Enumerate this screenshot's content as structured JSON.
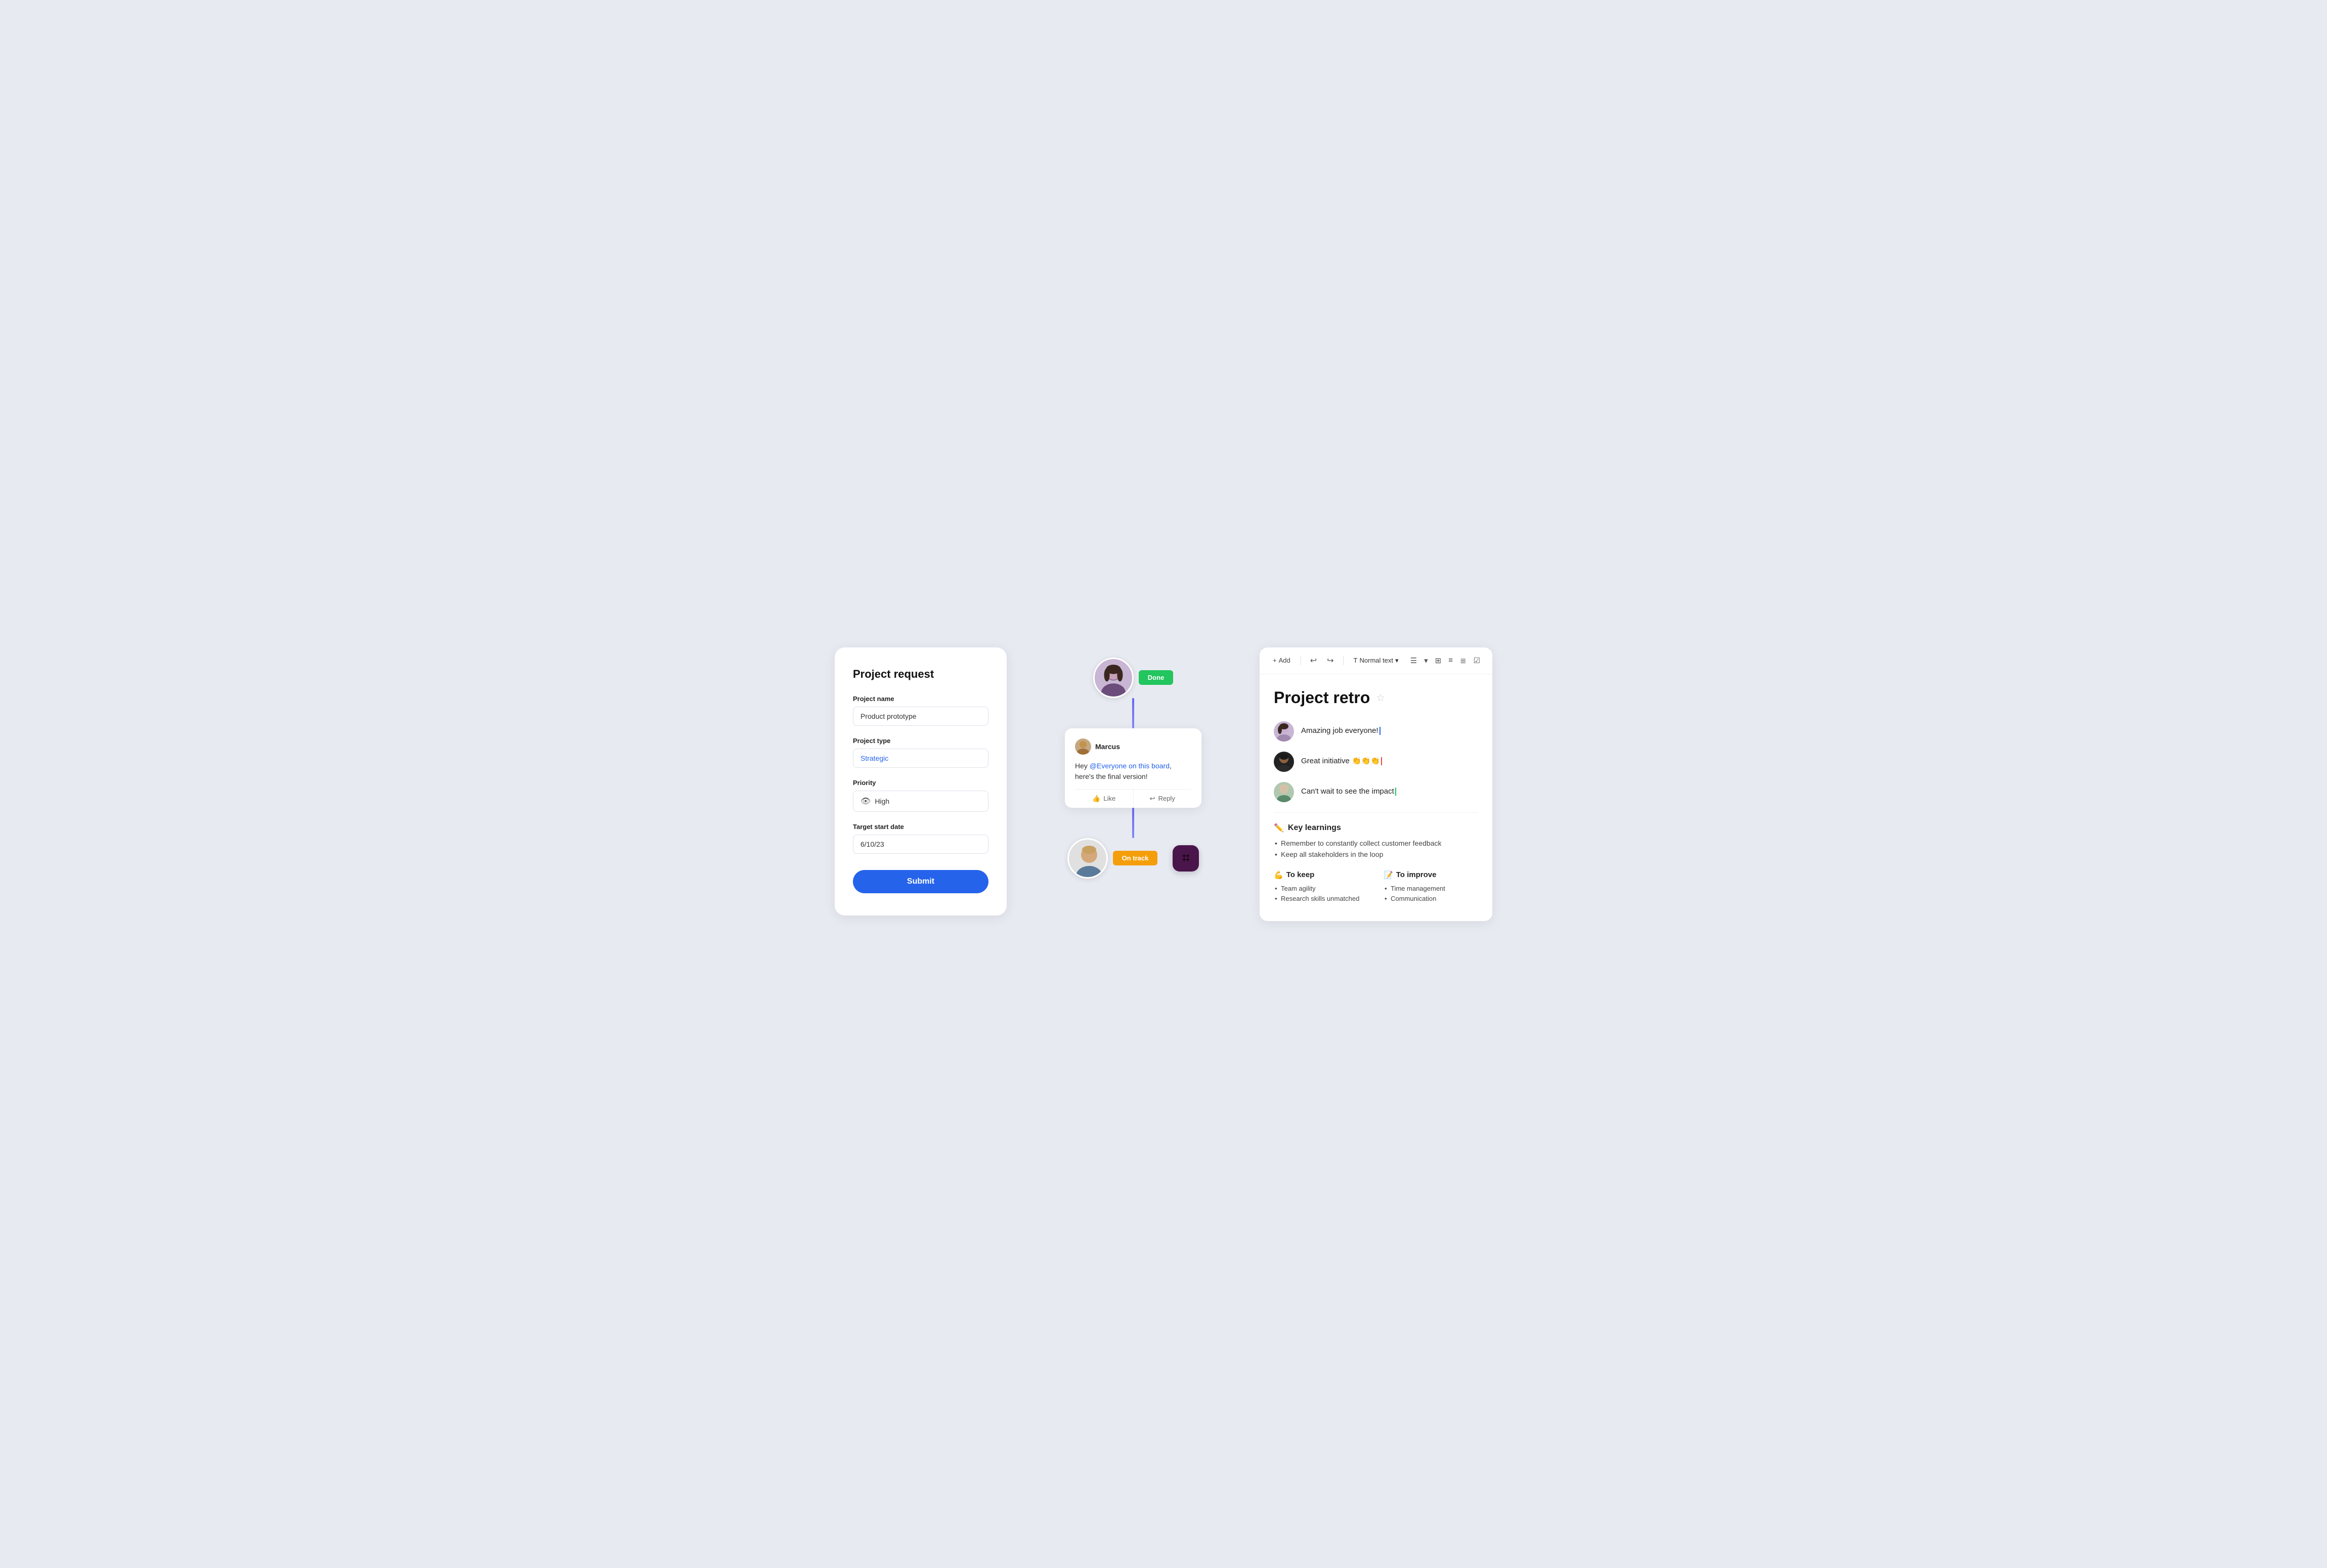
{
  "form": {
    "title": "Project request",
    "fields": {
      "project_name": {
        "label": "Project name",
        "value": "Product prototype"
      },
      "project_type": {
        "label": "Project type",
        "value": "Strategic"
      },
      "priority": {
        "label": "Priority",
        "value": "High"
      },
      "target_start_date": {
        "label": "Target start date",
        "value": "6/10/23"
      }
    },
    "submit_label": "Submit"
  },
  "middle": {
    "done_badge": "Done",
    "on_track_badge": "On track",
    "comment": {
      "author": "Marcus",
      "body_prefix": "Hey ",
      "mention": "@Everyone on this board",
      "body_suffix": ", here's the final version!",
      "like_label": "Like",
      "reply_label": "Reply"
    }
  },
  "retro": {
    "toolbar": {
      "add_label": "Add",
      "text_type": "Normal text",
      "undo_icon": "↩",
      "redo_icon": "↪"
    },
    "title": "Project retro",
    "star_icon": "☆",
    "comments": [
      {
        "text": "Amazing job everyone!",
        "cursor": "blue",
        "avatar_bg": "#c8b6d4"
      },
      {
        "text": "Great initiative 👏👏👏",
        "cursor": "red",
        "avatar_bg": "#222"
      },
      {
        "text": "Can't wait to see the impact",
        "cursor": "green",
        "avatar_bg": "#b0c8b0"
      }
    ],
    "key_learnings": {
      "heading": "Key learnings",
      "icon": "✏️",
      "items": [
        "Remember to constantly collect customer feedback",
        "Keep all stakeholders in the loop"
      ]
    },
    "to_keep": {
      "heading": "To keep",
      "icon": "💪",
      "items": [
        "Team agility",
        "Research skills unmatched"
      ]
    },
    "to_improve": {
      "heading": "To improve",
      "icon": "📝",
      "items": [
        "Time management",
        "Communication"
      ]
    }
  }
}
